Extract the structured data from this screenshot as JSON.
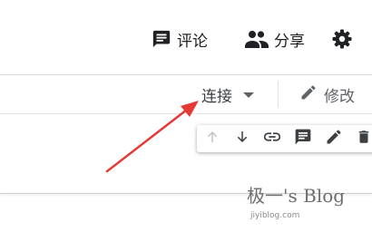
{
  "header": {
    "comment_label": "评论",
    "share_label": "分享",
    "icons": {
      "comment": "comment-icon",
      "share": "people-icon",
      "settings": "gear-icon"
    }
  },
  "toolbar": {
    "connect_label": "连接",
    "edit_label": "修改",
    "icons": {
      "connect_caret": "caret-down-icon",
      "edit": "pencil-icon"
    }
  },
  "action_bar": {
    "icons": [
      "arrow-up-icon",
      "arrow-down-icon",
      "link-icon",
      "comment-icon",
      "pencil-icon",
      "trash-icon"
    ]
  },
  "annotation": {
    "arrow_color": "#e53935"
  },
  "watermark": {
    "title": "极一's Blog",
    "url": "jiyiblog.com"
  },
  "colors": {
    "icon_dark": "#202124",
    "icon_gray": "#5f6368",
    "icon_disabled": "#c4c4c4",
    "divider": "#e0e0e0"
  }
}
